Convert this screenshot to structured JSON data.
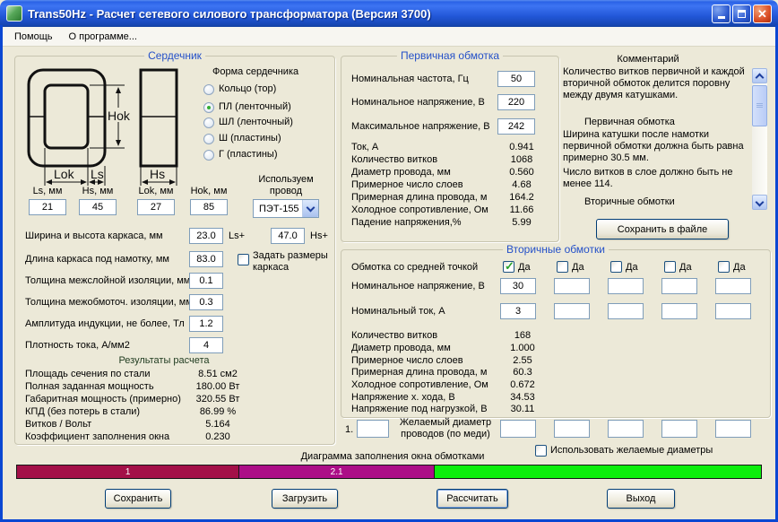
{
  "window": {
    "title": "Trans50Hz - Расчет сетевого силового трансформатора (Версия 3700)",
    "menu_items": [
      "Помощь",
      "О программе..."
    ],
    "legend_color": "#2450C8"
  },
  "core": {
    "legend": "Сердечник",
    "diagram": {
      "hok": "Hok",
      "lok": "Lok",
      "ls": "Ls",
      "hs": "Hs"
    },
    "shape_group_label": "Форма сердечника",
    "shapes": [
      "Кольцо (тор)",
      "ПЛ (ленточный)",
      "ШЛ (ленточный)",
      "Ш (пластины)",
      "Г (пластины)"
    ],
    "selected_shape_index": 1,
    "dims": [
      {
        "label": "Ls, мм",
        "value": "21"
      },
      {
        "label": "Hs, мм",
        "value": "45"
      },
      {
        "label": "Lok, мм",
        "value": "27"
      },
      {
        "label": "Hok, мм",
        "value": "85"
      }
    ],
    "wire_label": "Используем провод",
    "wire_value": "ПЭТ-155",
    "width_height_label": "Ширина и высота каркаса, мм",
    "ls_plus_value": "23.0",
    "ls_plus_label": "Ls+",
    "hs_plus_value": "47.0",
    "hs_plus_label": "Hs+",
    "frame_checkbox_label": "Задать размеры каркаса",
    "params": [
      {
        "label": "Длина каркаса под намотку, мм",
        "value": "83.0"
      },
      {
        "label": "Толщина межслойной изоляции, мм",
        "value": "0.1"
      },
      {
        "label": "Толщина межобмоточ. изоляции, мм",
        "value": "0.3"
      },
      {
        "label": "Амплитуда индукции, не более, Тл",
        "value": "1.2"
      },
      {
        "label": "Плотность тока, А/мм2",
        "value": "4"
      }
    ],
    "results_title": "Результаты расчета",
    "results": [
      {
        "label": "Площадь сечения по стали",
        "value": "8.51 см2"
      },
      {
        "label": "Полная заданная мощность",
        "value": "180.00 Вт"
      },
      {
        "label": "Габаритная мощность (примерно)",
        "value": "320.55 Вт"
      },
      {
        "label": "КПД (без потерь в стали)",
        "value": "86.99 %"
      },
      {
        "label": "Витков / Вольт",
        "value": "5.164"
      },
      {
        "label": "Коэффициент заполнения окна",
        "value": "0.230"
      }
    ]
  },
  "primary": {
    "legend": "Первичная обмотка",
    "inputs": [
      {
        "label": "Номинальная частота, Гц",
        "value": "50"
      },
      {
        "label": "Номинальное напряжение, В",
        "value": "220"
      },
      {
        "label": "Максимальное напряжение, В",
        "value": "242"
      }
    ],
    "results": [
      {
        "label": "Ток, А",
        "value": "0.941"
      },
      {
        "label": "Количество витков",
        "value": "1068"
      },
      {
        "label": "Диаметр провода, мм",
        "value": "0.560"
      },
      {
        "label": "Примерное число слоев",
        "value": "4.68"
      },
      {
        "label": "Примерная длина провода, м",
        "value": "164.2"
      },
      {
        "label": "Холодное сопротивление, Ом",
        "value": "11.66"
      },
      {
        "label": "Падение напряжения,%",
        "value": "5.99"
      }
    ]
  },
  "comment": {
    "title": "Комментарий",
    "p1": "Количество витков первичной и каждой вторичной обмоток делится поровну между двумя катушками.",
    "h1": "Первичная обмотка",
    "p2": "Ширина катушки после намотки первичной обмотки должна быть равна примерно 30.5 мм.",
    "p3": "Число витков в слое должно быть не менее 114.",
    "h2": "Вторичные обмотки",
    "save_button": "Сохранить в файле"
  },
  "secondary": {
    "legend": "Вторичные обмотки",
    "midpoint_label": "Обмотка со средней точкой",
    "yes_label": "Да",
    "midpoint_checked": [
      true,
      false,
      false,
      false,
      false
    ],
    "voltage_label": "Номинальное напряжение, В",
    "voltage_values": [
      "30",
      "",
      "",
      "",
      ""
    ],
    "current_label": "Номинальный ток, А",
    "current_values": [
      "3",
      "",
      "",
      "",
      ""
    ],
    "results": [
      {
        "label": "Количество витков",
        "value": "168"
      },
      {
        "label": "Диаметр провода, мм",
        "value": "1.000"
      },
      {
        "label": "Примерное число слоев",
        "value": "2.55"
      },
      {
        "label": "Примерная длина провода, м",
        "value": "60.3"
      },
      {
        "label": "Холодное сопротивление, Ом",
        "value": "0.672"
      },
      {
        "label": "Напряжение х. хода, В",
        "value": "34.53"
      },
      {
        "label": "Напряжение под нагрузкой, В",
        "value": "30.11"
      }
    ],
    "desired_row_index": "1.",
    "desired_first_value": "",
    "desired_label": "Желаемый диаметр проводов  (по меди)",
    "desired_values": [
      "",
      "",
      "",
      "",
      ""
    ],
    "use_desired_label": "Использовать желаемые диаметры",
    "use_desired_checked": false
  },
  "bottom": {
    "diagram_label": "Диаграмма заполнения окна обмотками",
    "segments": [
      {
        "label": "1",
        "width_pct": 29.9,
        "color": "#A31048"
      },
      {
        "label": "2.1",
        "width_pct": 26.2,
        "color": "#AC0E87"
      },
      {
        "label": "",
        "width_pct": 43.9,
        "color": "#0CEE0C"
      }
    ],
    "buttons": [
      "Сохранить",
      "Загрузить",
      "Рассчитать",
      "Выход"
    ]
  }
}
